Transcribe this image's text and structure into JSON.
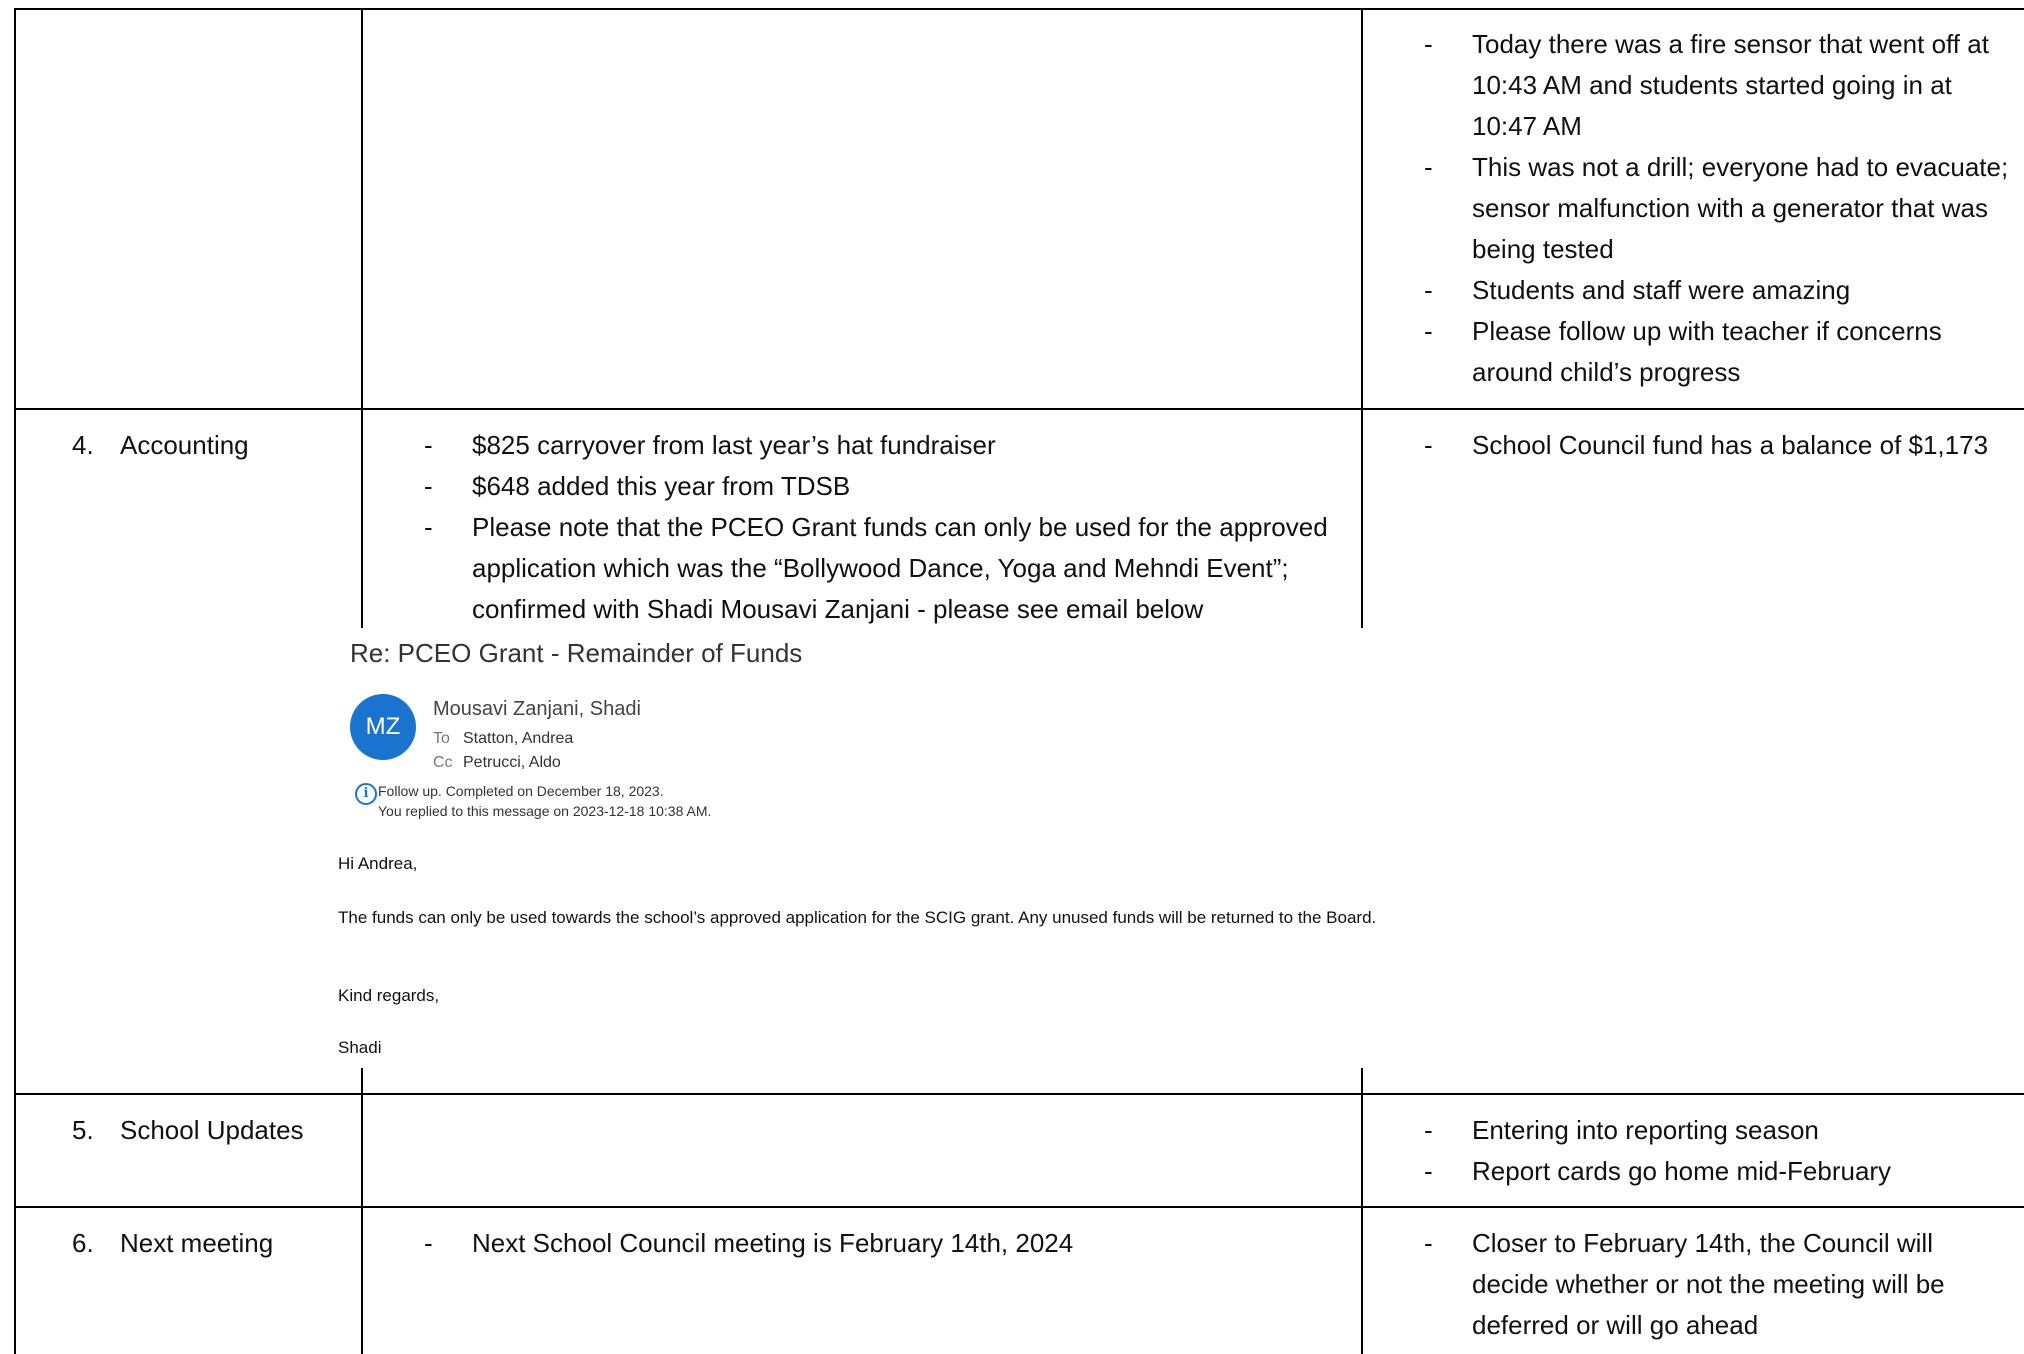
{
  "rows": {
    "row0": {
      "right_bullets": [
        "Today there was a fire sensor that went off at 10:43 AM and students started  going in at 10:47 AM",
        "This was not a drill; everyone had to evacuate; sensor malfunction with a generator that was being tested",
        "Students and staff were amazing",
        "Please follow up with teacher if concerns around child’s progress"
      ]
    },
    "accounting": {
      "number": "4.",
      "label": "Accounting",
      "middle_bullets": [
        "$825 carryover from last year’s hat fundraiser",
        "$648 added this year from TDSB",
        "Please note that the PCEO Grant funds can only be used for the approved application which was the “Bollywood Dance, Yoga and Mehndi Event”; confirmed with Shadi Mousavi Zanjani - please see email below"
      ],
      "right_bullets": [
        "School Council fund has a balance of $1,173"
      ]
    },
    "school_updates": {
      "number": "5.",
      "label": "School Updates",
      "right_bullets": [
        "Entering into reporting season",
        "Report cards go home mid-February"
      ]
    },
    "next_meeting": {
      "number": "6.",
      "label": "Next meeting",
      "middle_bullets": [
        "Next School Council meeting is February 14th, 2024"
      ],
      "right_bullets": [
        "Closer to February 14th, the Council will decide whether or not the meeting will be deferred or will go ahead"
      ]
    }
  },
  "bullet_marker": "-",
  "email": {
    "subject": "Re: PCEO Grant - Remainder of Funds",
    "avatar_initials": "MZ",
    "avatar_color": "#1a73cf",
    "sender": "Mousavi Zanjani, Shadi",
    "to_label": "To",
    "to": "Statton, Andrea",
    "cc_label": "Cc",
    "cc": "Petrucci, Aldo",
    "followup_line1": "Follow up.  Completed on December 18, 2023.",
    "followup_line2": "You replied to this message on 2023-12-18 10:38 AM.",
    "greeting": "Hi Andrea,",
    "body": "The funds can only be used towards the school’s approved application for the SCIG grant. Any unused funds will be returned to the Board.",
    "closing": "Kind regards,",
    "signature": "Shadi"
  }
}
